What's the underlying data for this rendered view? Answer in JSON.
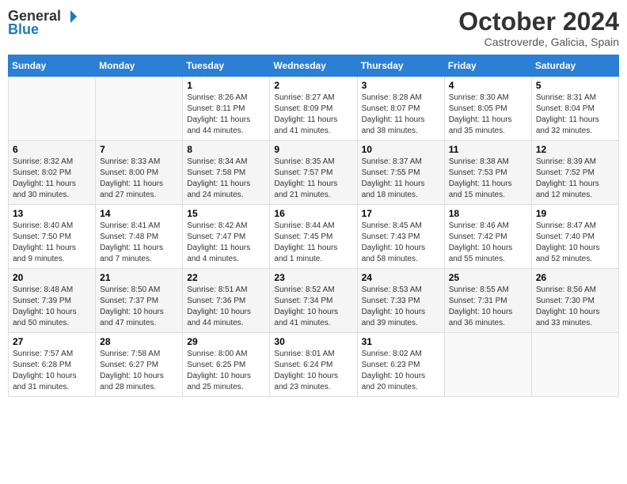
{
  "logo": {
    "general": "General",
    "blue": "Blue",
    "tagline": ""
  },
  "title": {
    "month_year": "October 2024",
    "location": "Castroverde, Galicia, Spain"
  },
  "weekdays": [
    "Sunday",
    "Monday",
    "Tuesday",
    "Wednesday",
    "Thursday",
    "Friday",
    "Saturday"
  ],
  "weeks": [
    [
      {
        "day": "",
        "sunrise": "",
        "sunset": "",
        "daylight": ""
      },
      {
        "day": "",
        "sunrise": "",
        "sunset": "",
        "daylight": ""
      },
      {
        "day": "1",
        "sunrise": "Sunrise: 8:26 AM",
        "sunset": "Sunset: 8:11 PM",
        "daylight": "Daylight: 11 hours and 44 minutes."
      },
      {
        "day": "2",
        "sunrise": "Sunrise: 8:27 AM",
        "sunset": "Sunset: 8:09 PM",
        "daylight": "Daylight: 11 hours and 41 minutes."
      },
      {
        "day": "3",
        "sunrise": "Sunrise: 8:28 AM",
        "sunset": "Sunset: 8:07 PM",
        "daylight": "Daylight: 11 hours and 38 minutes."
      },
      {
        "day": "4",
        "sunrise": "Sunrise: 8:30 AM",
        "sunset": "Sunset: 8:05 PM",
        "daylight": "Daylight: 11 hours and 35 minutes."
      },
      {
        "day": "5",
        "sunrise": "Sunrise: 8:31 AM",
        "sunset": "Sunset: 8:04 PM",
        "daylight": "Daylight: 11 hours and 32 minutes."
      }
    ],
    [
      {
        "day": "6",
        "sunrise": "Sunrise: 8:32 AM",
        "sunset": "Sunset: 8:02 PM",
        "daylight": "Daylight: 11 hours and 30 minutes."
      },
      {
        "day": "7",
        "sunrise": "Sunrise: 8:33 AM",
        "sunset": "Sunset: 8:00 PM",
        "daylight": "Daylight: 11 hours and 27 minutes."
      },
      {
        "day": "8",
        "sunrise": "Sunrise: 8:34 AM",
        "sunset": "Sunset: 7:58 PM",
        "daylight": "Daylight: 11 hours and 24 minutes."
      },
      {
        "day": "9",
        "sunrise": "Sunrise: 8:35 AM",
        "sunset": "Sunset: 7:57 PM",
        "daylight": "Daylight: 11 hours and 21 minutes."
      },
      {
        "day": "10",
        "sunrise": "Sunrise: 8:37 AM",
        "sunset": "Sunset: 7:55 PM",
        "daylight": "Daylight: 11 hours and 18 minutes."
      },
      {
        "day": "11",
        "sunrise": "Sunrise: 8:38 AM",
        "sunset": "Sunset: 7:53 PM",
        "daylight": "Daylight: 11 hours and 15 minutes."
      },
      {
        "day": "12",
        "sunrise": "Sunrise: 8:39 AM",
        "sunset": "Sunset: 7:52 PM",
        "daylight": "Daylight: 11 hours and 12 minutes."
      }
    ],
    [
      {
        "day": "13",
        "sunrise": "Sunrise: 8:40 AM",
        "sunset": "Sunset: 7:50 PM",
        "daylight": "Daylight: 11 hours and 9 minutes."
      },
      {
        "day": "14",
        "sunrise": "Sunrise: 8:41 AM",
        "sunset": "Sunset: 7:48 PM",
        "daylight": "Daylight: 11 hours and 7 minutes."
      },
      {
        "day": "15",
        "sunrise": "Sunrise: 8:42 AM",
        "sunset": "Sunset: 7:47 PM",
        "daylight": "Daylight: 11 hours and 4 minutes."
      },
      {
        "day": "16",
        "sunrise": "Sunrise: 8:44 AM",
        "sunset": "Sunset: 7:45 PM",
        "daylight": "Daylight: 11 hours and 1 minute."
      },
      {
        "day": "17",
        "sunrise": "Sunrise: 8:45 AM",
        "sunset": "Sunset: 7:43 PM",
        "daylight": "Daylight: 10 hours and 58 minutes."
      },
      {
        "day": "18",
        "sunrise": "Sunrise: 8:46 AM",
        "sunset": "Sunset: 7:42 PM",
        "daylight": "Daylight: 10 hours and 55 minutes."
      },
      {
        "day": "19",
        "sunrise": "Sunrise: 8:47 AM",
        "sunset": "Sunset: 7:40 PM",
        "daylight": "Daylight: 10 hours and 52 minutes."
      }
    ],
    [
      {
        "day": "20",
        "sunrise": "Sunrise: 8:48 AM",
        "sunset": "Sunset: 7:39 PM",
        "daylight": "Daylight: 10 hours and 50 minutes."
      },
      {
        "day": "21",
        "sunrise": "Sunrise: 8:50 AM",
        "sunset": "Sunset: 7:37 PM",
        "daylight": "Daylight: 10 hours and 47 minutes."
      },
      {
        "day": "22",
        "sunrise": "Sunrise: 8:51 AM",
        "sunset": "Sunset: 7:36 PM",
        "daylight": "Daylight: 10 hours and 44 minutes."
      },
      {
        "day": "23",
        "sunrise": "Sunrise: 8:52 AM",
        "sunset": "Sunset: 7:34 PM",
        "daylight": "Daylight: 10 hours and 41 minutes."
      },
      {
        "day": "24",
        "sunrise": "Sunrise: 8:53 AM",
        "sunset": "Sunset: 7:33 PM",
        "daylight": "Daylight: 10 hours and 39 minutes."
      },
      {
        "day": "25",
        "sunrise": "Sunrise: 8:55 AM",
        "sunset": "Sunset: 7:31 PM",
        "daylight": "Daylight: 10 hours and 36 minutes."
      },
      {
        "day": "26",
        "sunrise": "Sunrise: 8:56 AM",
        "sunset": "Sunset: 7:30 PM",
        "daylight": "Daylight: 10 hours and 33 minutes."
      }
    ],
    [
      {
        "day": "27",
        "sunrise": "Sunrise: 7:57 AM",
        "sunset": "Sunset: 6:28 PM",
        "daylight": "Daylight: 10 hours and 31 minutes."
      },
      {
        "day": "28",
        "sunrise": "Sunrise: 7:58 AM",
        "sunset": "Sunset: 6:27 PM",
        "daylight": "Daylight: 10 hours and 28 minutes."
      },
      {
        "day": "29",
        "sunrise": "Sunrise: 8:00 AM",
        "sunset": "Sunset: 6:25 PM",
        "daylight": "Daylight: 10 hours and 25 minutes."
      },
      {
        "day": "30",
        "sunrise": "Sunrise: 8:01 AM",
        "sunset": "Sunset: 6:24 PM",
        "daylight": "Daylight: 10 hours and 23 minutes."
      },
      {
        "day": "31",
        "sunrise": "Sunrise: 8:02 AM",
        "sunset": "Sunset: 6:23 PM",
        "daylight": "Daylight: 10 hours and 20 minutes."
      },
      {
        "day": "",
        "sunrise": "",
        "sunset": "",
        "daylight": ""
      },
      {
        "day": "",
        "sunrise": "",
        "sunset": "",
        "daylight": ""
      }
    ]
  ]
}
